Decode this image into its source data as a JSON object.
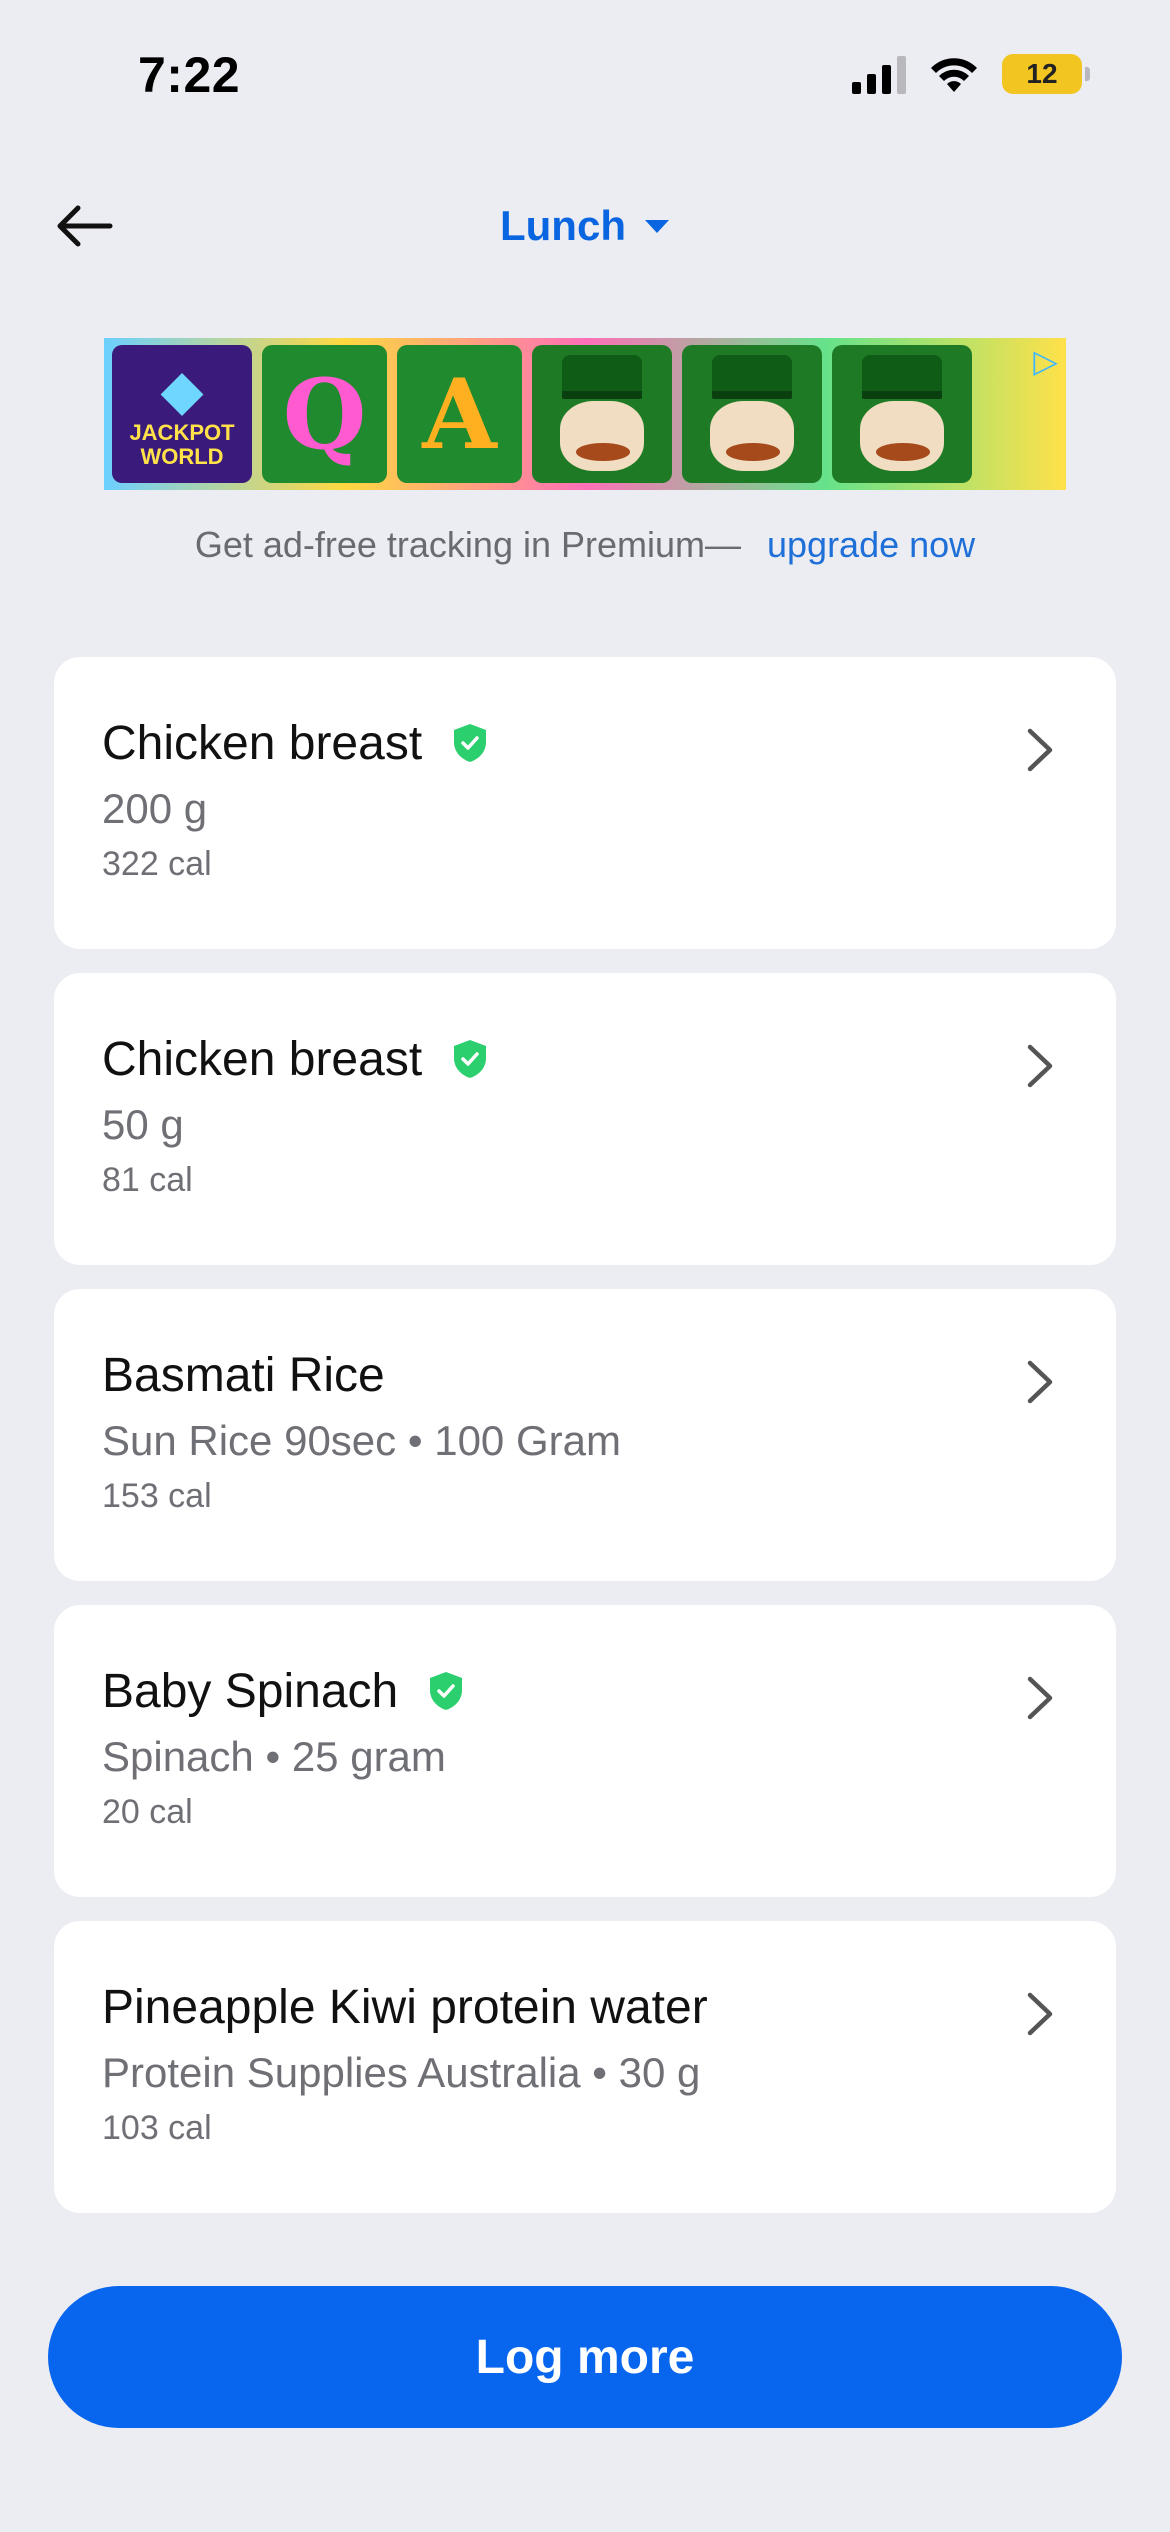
{
  "status_bar": {
    "time": "7:22",
    "battery": "12",
    "battery_color": "#f3c520"
  },
  "header": {
    "back_icon": "arrow-left-icon",
    "meal": "Lunch",
    "dropdown_icon": "caret-down-icon",
    "accent_color": "#0a66e0"
  },
  "ad": {
    "brand_text_line1": "JACKPOT",
    "brand_text_line2": "WORLD",
    "tiles": [
      "Q",
      "A"
    ],
    "note": "Get ad-free tracking in Premium—",
    "upgrade_link": "upgrade now"
  },
  "foods": [
    {
      "name": "Chicken breast",
      "verified": true,
      "detail": "200 g",
      "calories": "322 cal"
    },
    {
      "name": "Chicken breast",
      "verified": true,
      "detail": "50 g",
      "calories": "81 cal"
    },
    {
      "name": "Basmati Rice",
      "verified": false,
      "detail": "Sun Rice 90sec • 100 Gram",
      "calories": "153 cal"
    },
    {
      "name": "Baby Spinach",
      "verified": true,
      "detail": "Spinach • 25 gram",
      "calories": "20 cal"
    },
    {
      "name": "Pineapple Kiwi protein water",
      "verified": false,
      "detail": "Protein Supplies Australia • 30 g",
      "calories": "103 cal"
    }
  ],
  "verified_color": "#2ccf6e",
  "actions": {
    "log_more": "Log more",
    "button_color": "#0866ee"
  }
}
